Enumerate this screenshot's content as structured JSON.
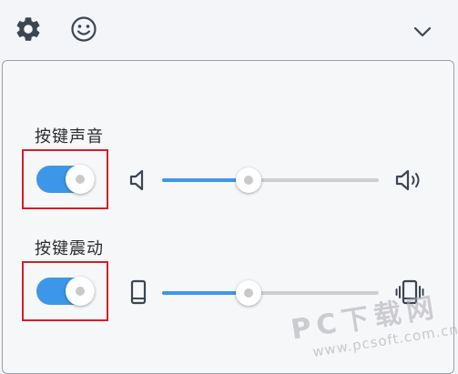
{
  "toolbar": {
    "left_icons": [
      "gear-icon",
      "smiley-icon"
    ],
    "right_icon": "chevron-down-icon"
  },
  "key_sound": {
    "label": "按键声音",
    "toggle_on": true,
    "volume_level": 0.4,
    "min_icon": "speaker-mute-icon",
    "max_icon": "speaker-loud-icon"
  },
  "key_vibration": {
    "label": "按键震动",
    "toggle_on": true,
    "intensity_level": 0.4,
    "min_icon": "phone-icon",
    "max_icon": "phone-vibrate-icon"
  },
  "watermark": {
    "main": "PC下载网",
    "url": "www.pcsoft.com.cn"
  },
  "colors": {
    "accent": "#3d97e8",
    "highlight": "#d51f24",
    "icon": "#3c4550"
  }
}
